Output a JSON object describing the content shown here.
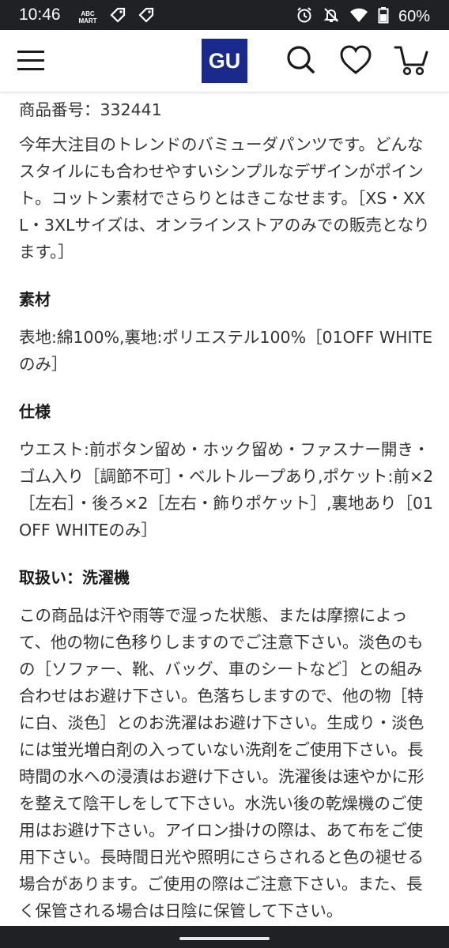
{
  "status_bar": {
    "time": "10:46",
    "notification_icons": [
      "abc-mart-icon",
      "tag-icon",
      "tag-icon"
    ],
    "abc_mart_line1": "ABC",
    "abc_mart_line2": "MART",
    "battery_percent": "60%"
  },
  "header": {
    "logo_text": "GU",
    "logo_color": "#1a2a8c",
    "icons": [
      "menu-icon",
      "search-icon",
      "heart-icon",
      "cart-icon"
    ]
  },
  "product": {
    "number_label": "商品番号：332441",
    "description": "今年大注目のトレンドのバミューダパンツです。どんなスタイルにも合わせやすいシンプルなデザインがポイント。コットン素材でさらりとはきこなせます。［XS・XXL・3XLサイズは、オンラインストアのみでの販売となります。］"
  },
  "sections": [
    {
      "heading": "素材",
      "body": "表地:綿100%,裏地:ポリエステル100%［01OFF WHITEのみ］"
    },
    {
      "heading": "仕様",
      "body": "ウエスト:前ボタン留め・ホック留め・ファスナー開き・ゴム入り［調節不可］・ベルトループあり,ポケット:前×2［左右］・後ろ×2［左右・飾りポケット］,裏地あり［01OFF WHITEのみ］"
    },
    {
      "heading": "取扱い：洗濯機",
      "body": "この商品は汗や雨等で湿った状態、または摩擦によって、他の物に色移りしますのでご注意下さい。淡色のもの［ソファー、靴、バッグ、車のシートなど］との組み合わせはお避け下さい。色落ちしますので、他の物［特に白、淡色］とのお洗濯はお避け下さい。生成り・淡色には蛍光増白剤の入っていない洗剤をご使用下さい。長時間の水への浸漬はお避け下さい。洗濯後は速やかに形を整えて陰干しをして下さい。水洗い後の乾燥機のご使用はお避け下さい。アイロン掛けの際は、あて布をご使用下さい。長時間日光や照明にさらされると色の褪せる場合があります。ご使用の際はご注意下さい。また、長く保管される場合は日陰に保管して下さい。"
    }
  ]
}
